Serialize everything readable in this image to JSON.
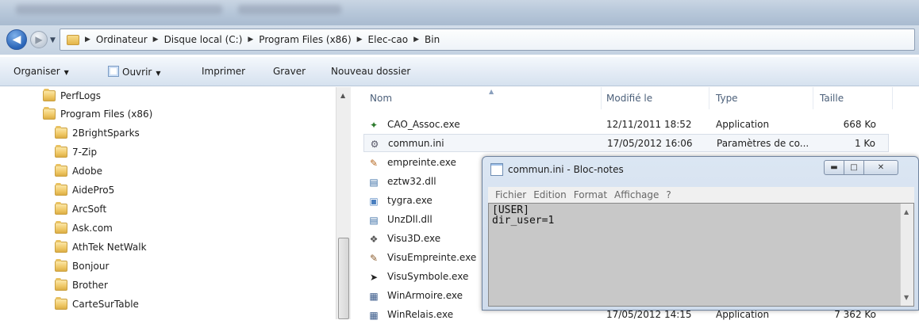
{
  "address": {
    "crumbs": [
      "Ordinateur",
      "Disque local (C:)",
      "Program Files (x86)",
      "Elec-cao",
      "Bin"
    ]
  },
  "toolbar": {
    "organize": "Organiser",
    "open": "Ouvrir",
    "print": "Imprimer",
    "burn": "Graver",
    "new_folder": "Nouveau dossier"
  },
  "nav": {
    "items": [
      "PerfLogs",
      "Program Files (x86)",
      "2BrightSparks",
      "7-Zip",
      "Adobe",
      "AidePro5",
      "ArcSoft",
      "Ask.com",
      "AthTek NetWalk",
      "Bonjour",
      "Brother",
      "CarteSurTable"
    ]
  },
  "filelist": {
    "columns": {
      "name": "Nom",
      "modified": "Modifié le",
      "type": "Type",
      "size": "Taille"
    },
    "files": [
      {
        "name": "CAO_Assoc.exe",
        "modified": "12/11/2011 18:52",
        "type": "Application",
        "size": "668 Ko",
        "icon": "cao-app-icon"
      },
      {
        "name": "commun.ini",
        "modified": "17/05/2012 16:06",
        "type": "Paramètres de co...",
        "size": "1 Ko",
        "icon": "ini-file-icon"
      },
      {
        "name": "empreinte.exe",
        "modified": "",
        "type": "",
        "size": "",
        "icon": "pen-app-icon"
      },
      {
        "name": "eztw32.dll",
        "modified": "",
        "type": "",
        "size": "",
        "icon": "dll-file-icon"
      },
      {
        "name": "tygra.exe",
        "modified": "",
        "type": "",
        "size": "",
        "icon": "tygra-app-icon"
      },
      {
        "name": "UnzDll.dll",
        "modified": "",
        "type": "",
        "size": "",
        "icon": "dll-file-icon"
      },
      {
        "name": "Visu3D.exe",
        "modified": "",
        "type": "",
        "size": "",
        "icon": "visu3d-app-icon"
      },
      {
        "name": "VisuEmpreinte.exe",
        "modified": "",
        "type": "",
        "size": "",
        "icon": "visu-pen-app-icon"
      },
      {
        "name": "VisuSymbole.exe",
        "modified": "",
        "type": "",
        "size": "",
        "icon": "visu-symbol-app-icon"
      },
      {
        "name": "WinArmoire.exe",
        "modified": "",
        "type": "",
        "size": "",
        "icon": "winarmoire-app-icon"
      },
      {
        "name": "WinRelais.exe",
        "modified": "17/05/2012 14:15",
        "type": "Application",
        "size": "7 362 Ko",
        "icon": "winrelais-app-icon"
      }
    ]
  },
  "notepad": {
    "title": "commun.ini - Bloc-notes",
    "menu": [
      "Fichier",
      "Edition",
      "Format",
      "Affichage",
      "?"
    ],
    "content": "[USER]\ndir_user=1"
  }
}
